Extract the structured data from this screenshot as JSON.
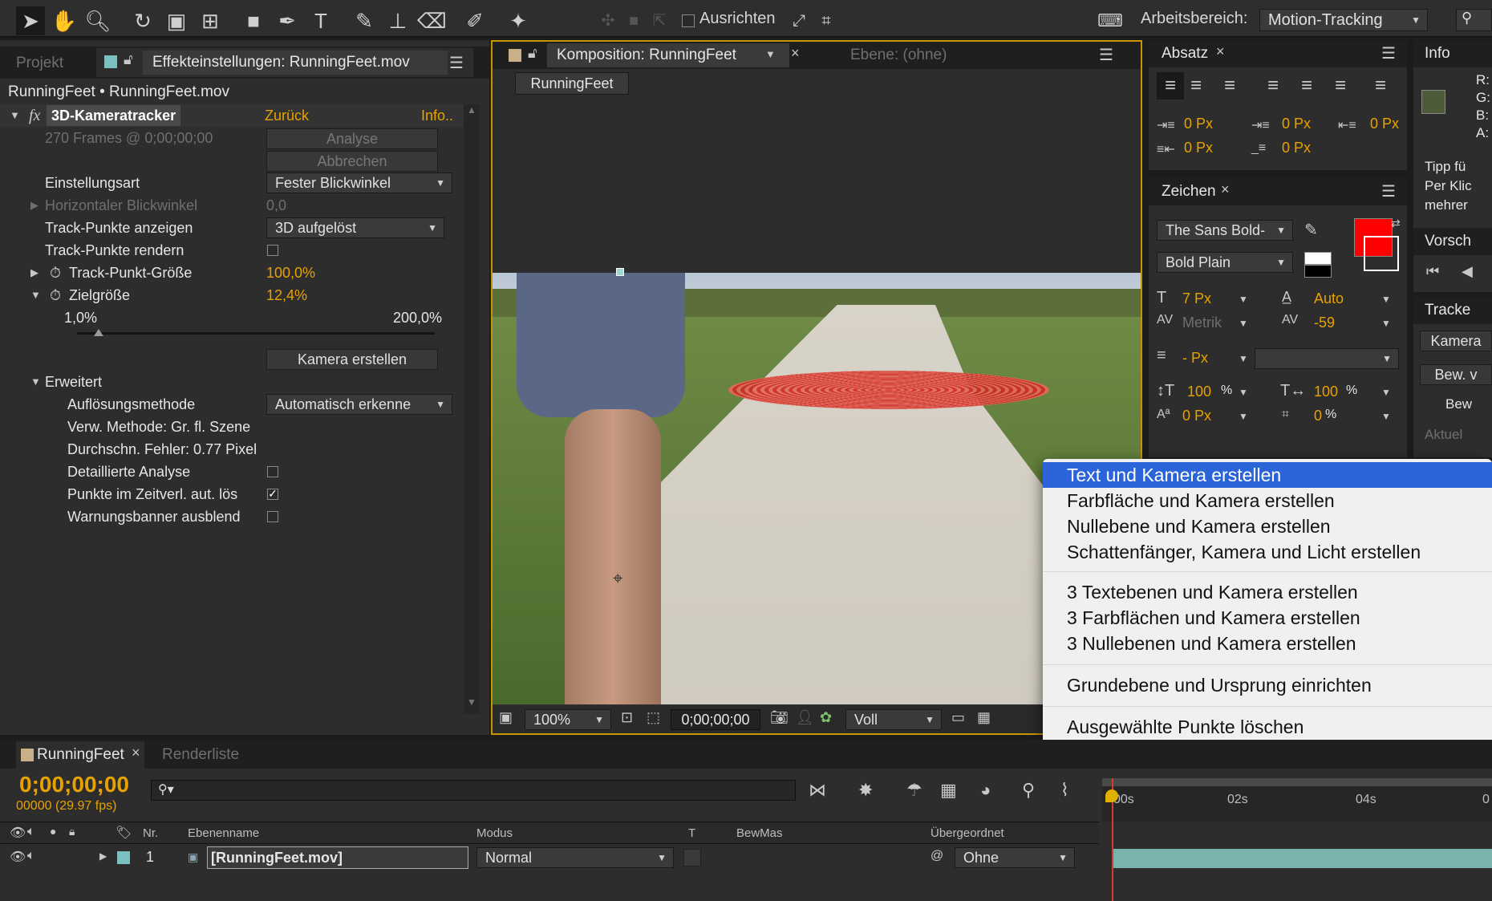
{
  "toolbar": {
    "align_label": "Ausrichten",
    "workspace_label": "Arbeitsbereich:",
    "workspace_value": "Motion-Tracking"
  },
  "left_panel": {
    "tab_project": "Projekt",
    "tab_effects": "Effekteinstellungen: RunningFeet.mov",
    "breadcrumb": "RunningFeet • RunningFeet.mov",
    "effect_name": "3D-Kameratracker",
    "reset_label": "Zurück",
    "info_label": "Info..",
    "frames_text": "270 Frames @ 0;00;00;00",
    "analyse_label": "Analyse",
    "cancel_label": "Abbrechen",
    "settings_label": "Einstellungsart",
    "settings_value": "Fester Blickwinkel",
    "horizontal_label": "Horizontaler Blickwinkel",
    "horizontal_value": "0,0",
    "show_points_label": "Track-Punkte anzeigen",
    "show_points_value": "3D aufgelöst",
    "render_points_label": "Track-Punkte rendern",
    "point_size_label": "Track-Punkt-Größe",
    "point_size_value": "100,0%",
    "target_size_label": "Zielgröße",
    "target_size_value": "12,4%",
    "slider_min": "1,0%",
    "slider_max": "200,0%",
    "slider_level": 0.06,
    "create_camera_label": "Kamera erstellen",
    "advanced_label": "Erweitert",
    "solve_method_label": "Auflösungsmethode",
    "solve_method_value": "Automatisch erkenne",
    "used_method": "Verw. Methode: Gr. fl. Szene",
    "avg_error": "Durchschn. Fehler: 0.77 Pixel",
    "detailed_label": "Detaillierte Analyse",
    "auto_delete_label": "Punkte im Zeitverl. aut. lös",
    "hide_banner_label": "Warnungsbanner ausblend"
  },
  "comp_panel": {
    "tab_comp": "Komposition: RunningFeet",
    "tab_layer": "Ebene: (ohne)",
    "comp_button": "RunningFeet",
    "zoom": "100%",
    "timecode": "0;00;00;00",
    "quality": "Voll"
  },
  "paragraph_panel": {
    "tab": "Absatz",
    "indent_left": "0 Px",
    "indent_first": "0 Px",
    "indent_right": "0 Px",
    "space_before": "0 Px",
    "space_after": "0 Px"
  },
  "character_panel": {
    "tab": "Zeichen",
    "font": "The Sans Bold-",
    "style": "Bold Plain",
    "size": "7 Px",
    "leading": "Auto",
    "kerning": "Metrik",
    "tracking": "-59",
    "stroke": "- Px",
    "vscale": "100",
    "hscale": "100",
    "percent": "%",
    "baseline": "0 Px",
    "tsume": "0",
    "fill_color": "#ff0000",
    "stroke_color": "#ffffff"
  },
  "info_panel": {
    "tab": "Info",
    "r": "R:",
    "g": "G:",
    "b": "B:",
    "a": "A:",
    "tip1": "Tipp fü",
    "tip2": "Per Klic",
    "tip3": "mehrer",
    "preview": "Vorsch",
    "tracker": "Tracke",
    "camera": "Kamera",
    "bew": "Bew. v",
    "bew2": "Bew",
    "aktuel": "Aktuel"
  },
  "context_menu": {
    "items": [
      "Text und Kamera erstellen",
      "Farbfläche und Kamera erstellen",
      "Nullebene und Kamera erstellen",
      "Schattenfänger, Kamera und Licht erstellen",
      "3 Textebenen und Kamera erstellen",
      "3 Farbflächen und Kamera erstellen",
      "3 Nullebenen und Kamera erstellen",
      "Grundebene und Ursprung einrichten",
      "Ausgewählte Punkte löschen"
    ]
  },
  "timeline": {
    "tab_comp": "RunningFeet",
    "tab_render": "Renderliste",
    "timecode": "0;00;00;00",
    "frames": "00000 (29.97 fps)",
    "col_nr": "Nr.",
    "col_name": "Ebenenname",
    "col_mode": "Modus",
    "col_t": "T",
    "col_track": "BewMas",
    "col_parent": "Übergeordnet",
    "layer_nr": "1",
    "layer_name": "[RunningFeet.mov]",
    "layer_mode": "Normal",
    "layer_parent": "Ohne",
    "ruler_0": "00s",
    "ruler_2": "02s",
    "ruler_4": "04s",
    "ruler_6": "0"
  }
}
